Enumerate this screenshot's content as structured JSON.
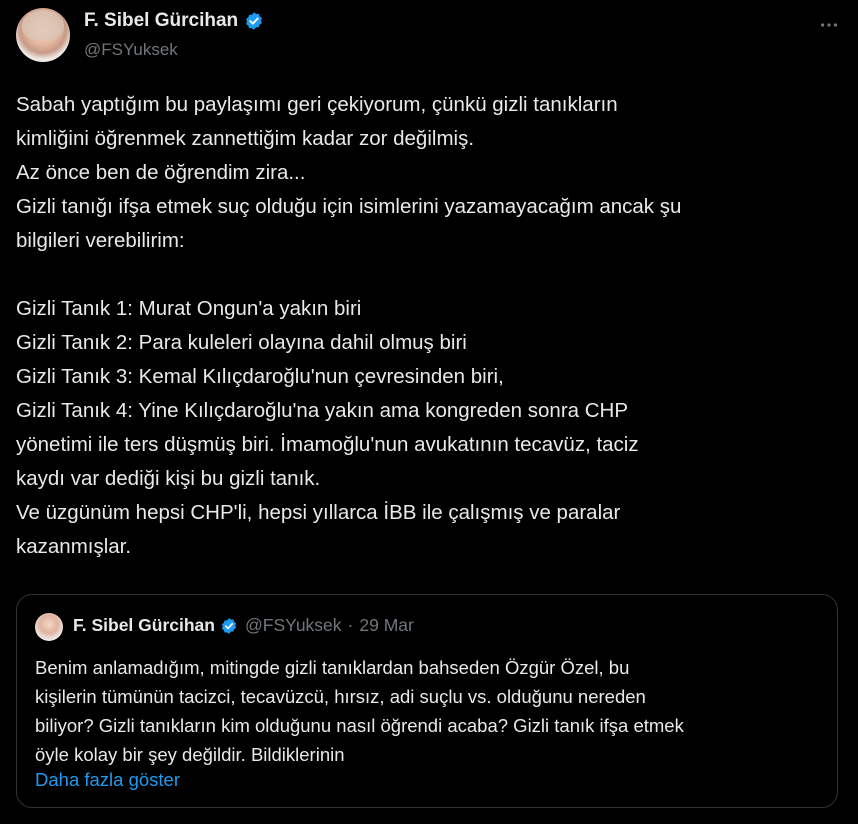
{
  "author": {
    "display_name": "F. Sibel Gürcihan",
    "handle": "@FSYuksek"
  },
  "more_icon": "more-horizontal-icon",
  "tweet_text": "Sabah yaptığım bu paylaşımı geri çekiyorum, çünkü gizli tanıkların\nkimliğini öğrenmek zannettiğim kadar zor değilmiş.\nAz önce ben de öğrendim zira...\nGizli tanığı ifşa etmek suç olduğu için isimlerini yazamayacağım ancak şu\nbilgileri verebilirim:\n\nGizli Tanık 1:  Murat Ongun'a yakın biri\nGizli Tanık 2: Para kuleleri olayına dahil olmuş biri\nGizli Tanık 3: Kemal Kılıçdaroğlu'nun çevresinden biri,\nGizli Tanık 4: Yine Kılıçdaroğlu'na yakın ama kongreden sonra CHP\nyönetimi ile ters düşmüş biri. İmamoğlu'nun avukatının tecavüz, taciz\nkaydı var dediği kişi bu gizli tanık.\n Ve üzgünüm hepsi CHP'li, hepsi yıllarca İBB ile çalışmış ve paralar\nkazanmışlar.",
  "quoted": {
    "display_name": "F. Sibel Gürcihan",
    "handle": "@FSYuksek",
    "separator": "·",
    "date": "29 Mar",
    "text": "Benim anlamadığım, mitingde gizli tanıklardan bahseden Özgür Özel, bu\nkişilerin tümünün tacizci, tecavüzcü, hırsız, adi suçlu vs. olduğunu nereden\nbiliyor? Gizli tanıkların kim olduğunu nasıl öğrendi acaba? Gizli tanık ifşa etmek\nöyle kolay bir şey değildir. Bildiklerinin",
    "show_more": "Daha fazla göster"
  },
  "colors": {
    "background": "#000000",
    "text": "#e7e9ea",
    "muted": "#71767b",
    "accent": "#1d9bf0",
    "border": "#2f3336"
  }
}
